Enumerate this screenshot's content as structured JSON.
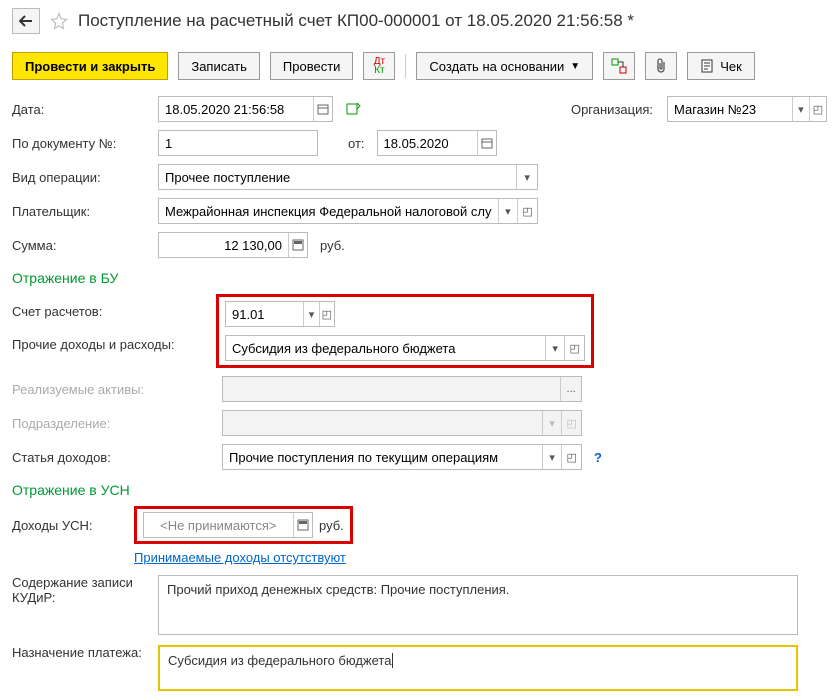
{
  "header": {
    "title": "Поступление на расчетный счет КП00-000001 от 18.05.2020 21:56:58 *"
  },
  "toolbar": {
    "post_close": "Провести и закрыть",
    "write": "Записать",
    "post": "Провести",
    "create_based": "Создать на основании",
    "check": "Чек"
  },
  "fields": {
    "date_label": "Дата:",
    "date_value": "18.05.2020 21:56:58",
    "org_label": "Организация:",
    "org_value": "Магазин №23",
    "doc_num_label": "По документу №:",
    "doc_num_value": "1",
    "from_label": "от:",
    "from_value": "18.05.2020",
    "op_type_label": "Вид операции:",
    "op_type_value": "Прочее поступление",
    "payer_label": "Плательщик:",
    "payer_value": "Межрайонная инспекция Федеральной налоговой службы",
    "sum_label": "Сумма:",
    "sum_value": "12 130,00",
    "currency": "руб."
  },
  "section_bu": {
    "title": "Отражение в БУ",
    "account_label": "Счет расчетов:",
    "account_value": "91.01",
    "other_label": "Прочие доходы и расходы:",
    "other_value": "Субсидия из федерального бюджета",
    "assets_label": "Реализуемые активы:",
    "assets_value": "",
    "division_label": "Подразделение:",
    "division_value": "",
    "income_label": "Статья доходов:",
    "income_value": "Прочие поступления по текущим операциям"
  },
  "section_usn": {
    "title": "Отражение в УСН",
    "income_label": "Доходы УСН:",
    "income_value": "<Не принимаются>",
    "currency": "руб.",
    "link": "Принимаемые доходы отсутствуют",
    "kudir_label": "Содержание записи КУДиР:",
    "kudir_value": "Прочий приход денежных средств: Прочие поступления.",
    "purpose_label": "Назначение платежа:",
    "purpose_value": "Субсидия из федерального бюджета"
  }
}
